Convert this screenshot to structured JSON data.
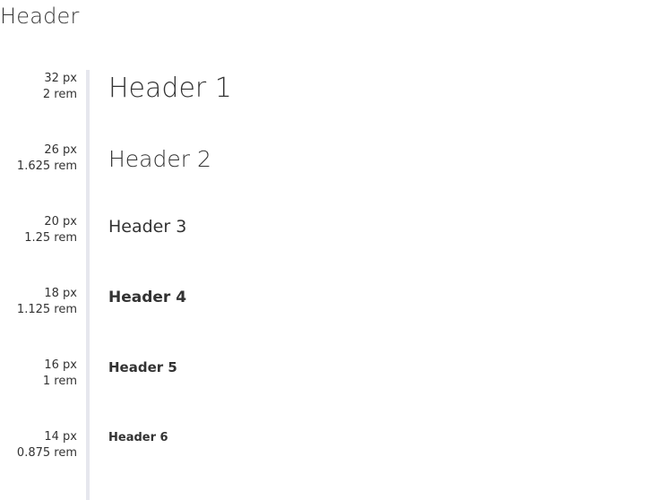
{
  "page": {
    "title": "Header"
  },
  "headers": [
    {
      "px": "32 px",
      "rem": "2 rem",
      "label": "Header 1"
    },
    {
      "px": "26 px",
      "rem": "1.625 rem",
      "label": "Header 2"
    },
    {
      "px": "20 px",
      "rem": "1.25 rem",
      "label": "Header 3"
    },
    {
      "px": "18 px",
      "rem": "1.125 rem",
      "label": "Header 4"
    },
    {
      "px": "16 px",
      "rem": "1 rem",
      "label": "Header 5"
    },
    {
      "px": "14 px",
      "rem": "0.875 rem",
      "label": "Header 6"
    }
  ]
}
